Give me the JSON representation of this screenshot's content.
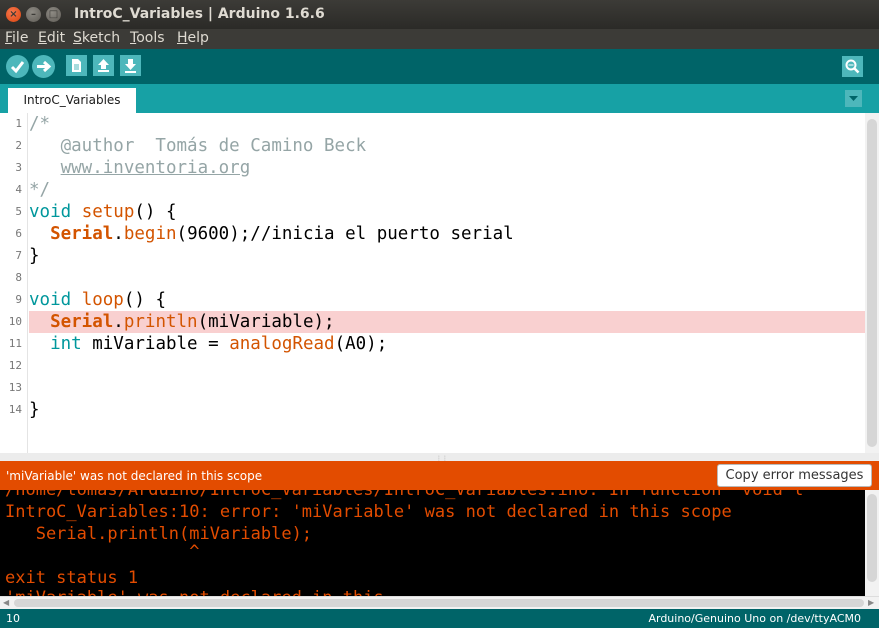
{
  "window": {
    "title": "IntroC_Variables | Arduino 1.6.6"
  },
  "menu": [
    "File",
    "Edit",
    "Sketch",
    "Tools",
    "Help"
  ],
  "tabs": [
    {
      "label": "IntroC_Variables"
    }
  ],
  "editor": {
    "line_numbers": [
      "1",
      "2",
      "3",
      "4",
      "5",
      "6",
      "7",
      "8",
      "9",
      "10",
      "11",
      "12",
      "13",
      "14"
    ],
    "highlighted_line": 10
  },
  "errorbar": {
    "message": "'miVariable' was not declared in this scope",
    "copy_button": "Copy error messages"
  },
  "console": {
    "lines": [
      "/home/tomas/Arduino/IntroC_Variables/IntroC_Variables.ino: In function 'void l",
      "IntroC_Variables:10: error: 'miVariable' was not declared in this scope",
      "   Serial.println(miVariable);",
      "                  ^",
      "exit status 1",
      "'miVariable' was not declared in this"
    ]
  },
  "status": {
    "line": "10",
    "board": "Arduino/Genuino Uno on /dev/ttyACM0"
  },
  "colors": {
    "toolbar": "#006468",
    "tabbar": "#17a1a5",
    "error": "#e34c00",
    "keyword": "#00979c",
    "function": "#d35400",
    "comment": "#95a5a6",
    "highlight": "#f9d0d0"
  }
}
